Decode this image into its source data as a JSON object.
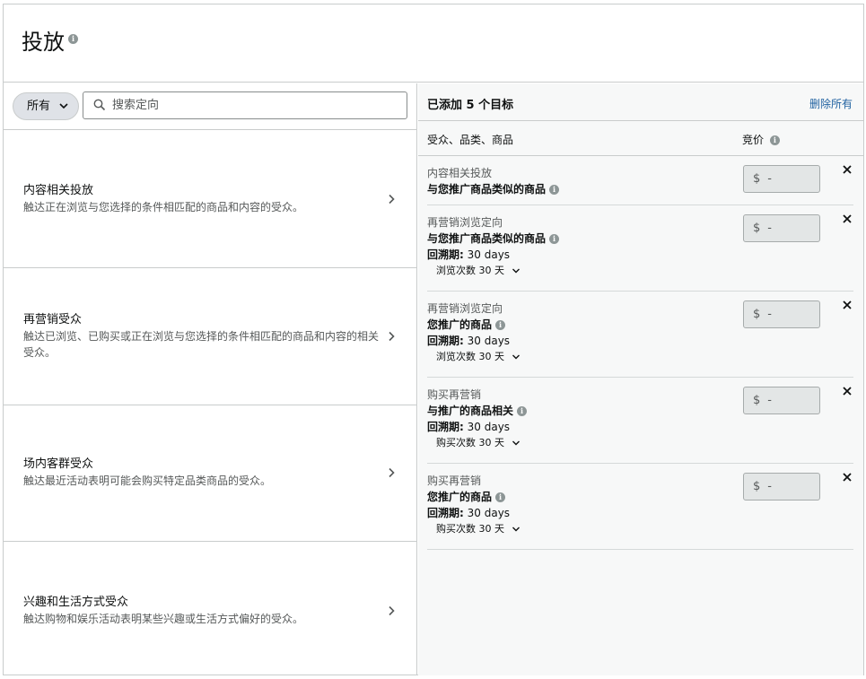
{
  "header": {
    "title": "投放"
  },
  "filter": {
    "selected": "所有",
    "search_placeholder": "搜索定向"
  },
  "categories": [
    {
      "title": "内容相关投放",
      "desc": "触达正在浏览与您选择的条件相匹配的商品和内容的受众。"
    },
    {
      "title": "再营销受众",
      "desc": "触达已浏览、已购买或正在浏览与您选择的条件相匹配的商品和内容的相关受众。"
    },
    {
      "title": "场内客群受众",
      "desc": "触达最近活动表明可能会购买特定品类商品的受众。"
    },
    {
      "title": "兴趣和生活方式受众",
      "desc": "触达购物和娱乐活动表明某些兴趣或生活方式偏好的受众。"
    }
  ],
  "panel": {
    "added_title": "已添加 5 个目标",
    "remove_all": "删除所有",
    "col_audience": "受众、品类、商品",
    "col_bid": "竞价"
  },
  "targets": [
    {
      "type": "内容相关投放",
      "main": "与您推广商品类似的商品",
      "lookback_label": "",
      "lookback_value": "",
      "sub": "",
      "currency": "$",
      "bid": "-"
    },
    {
      "type": "再营销浏览定向",
      "main": "与您推广商品类似的商品",
      "lookback_label": "回溯期:",
      "lookback_value": "30 days",
      "sub": "浏览次数 30 天",
      "currency": "$",
      "bid": "-"
    },
    {
      "type": "再营销浏览定向",
      "main": "您推广的商品",
      "lookback_label": "回溯期:",
      "lookback_value": "30 days",
      "sub": "浏览次数 30 天",
      "currency": "$",
      "bid": "-"
    },
    {
      "type": "购买再营销",
      "main": "与推广的商品相关",
      "lookback_label": "回溯期:",
      "lookback_value": "30 days",
      "sub": "购买次数 30 天",
      "currency": "$",
      "bid": "-"
    },
    {
      "type": "购买再营销",
      "main": "您推广的商品",
      "lookback_label": "回溯期:",
      "lookback_value": "30 days",
      "sub": "购买次数 30 天",
      "currency": "$",
      "bid": "-"
    }
  ],
  "colors": {
    "link": "#2162a1",
    "border": "#c9cccc",
    "panel_bg": "#f7f8f8",
    "pill_bg": "#dfe2e7"
  }
}
